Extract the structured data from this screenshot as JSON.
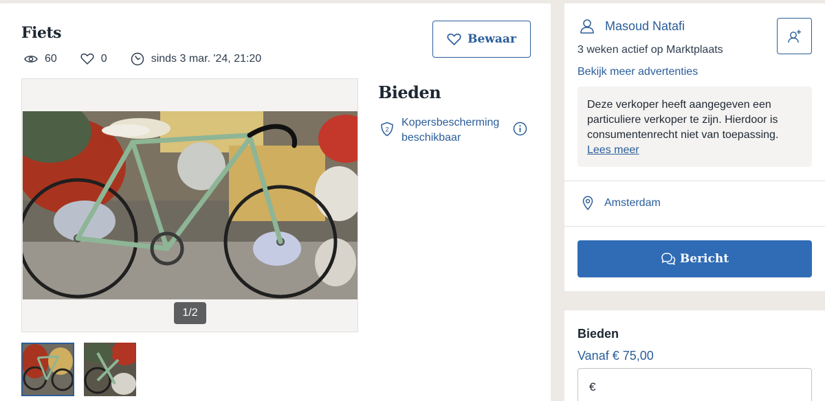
{
  "listing": {
    "title": "Fiets",
    "views": "60",
    "favorites": "0",
    "since": "sinds 3 mar. '24, 21:20",
    "save_label": "Bewaar",
    "photo_counter": "1/2"
  },
  "bidding_panel": {
    "title": "Bieden",
    "protection_label": "Kopersbescherming beschikbaar"
  },
  "seller": {
    "name": "Masoud Natafi",
    "active_text": "3 weken actief op Marktplaats",
    "more_ads_link": "Bekijk meer advertenties",
    "notice_text": "Deze verkoper heeft aangegeven een particuliere verkoper te zijn. Hierdoor is consumentenrecht niet van toepassing.",
    "notice_link": "Lees meer",
    "location": "Amsterdam",
    "message_button": "Bericht"
  },
  "bid_card": {
    "title": "Bieden",
    "from_text": "Vanaf € 75,00",
    "currency_symbol": "€",
    "input_value": "",
    "input_placeholder": ""
  },
  "colors": {
    "accent_blue": "#2a5d99",
    "button_blue": "#2f6cb5",
    "page_bg": "#edeae6"
  }
}
